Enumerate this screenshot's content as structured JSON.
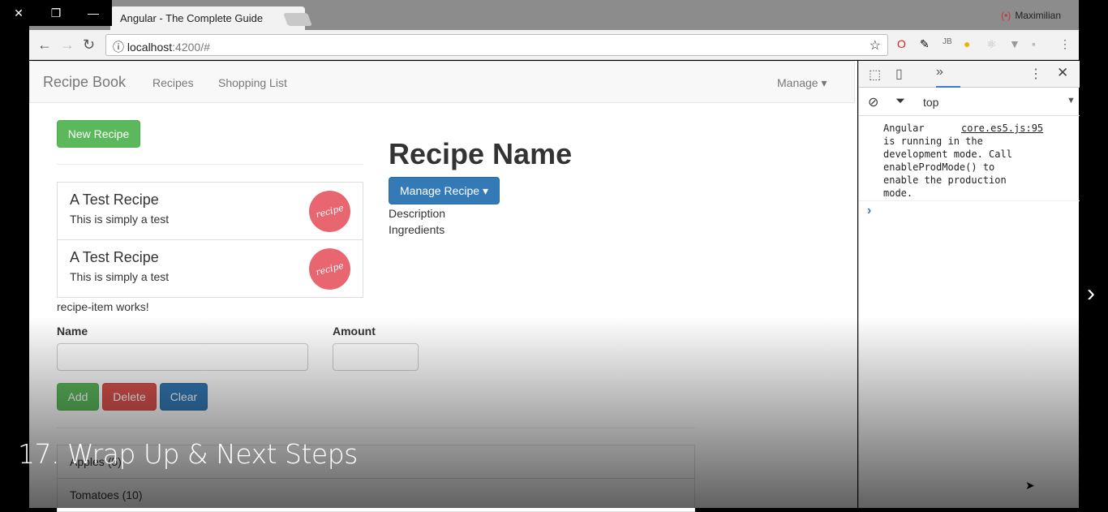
{
  "window_controls": {
    "close": "✕",
    "restore": "❐",
    "minimize": "—"
  },
  "browser": {
    "tab_title": "Angular - The Complete Guide",
    "tab_close": "×",
    "user": "Maximilian",
    "url_host": "localhost",
    "url_rest": ":4200/#"
  },
  "navbar": {
    "brand": "Recipe Book",
    "links": [
      "Recipes",
      "Shopping List"
    ],
    "manage": "Manage ▾"
  },
  "recipes": {
    "new_button": "New Recipe",
    "items": [
      {
        "name": "A Test Recipe",
        "description": "This is simply a test",
        "image_text": "recipe"
      },
      {
        "name": "A Test Recipe",
        "description": "This is simply a test",
        "image_text": "recipe"
      }
    ],
    "item_works": "recipe-item works!"
  },
  "detail": {
    "title": "Recipe Name",
    "manage_button": "Manage Recipe ▾",
    "description": "Description",
    "ingredients": "Ingredients"
  },
  "shopping": {
    "name_label": "Name",
    "amount_label": "Amount",
    "add": "Add",
    "delete": "Delete",
    "clear": "Clear",
    "items": [
      "Apples (5)",
      "Tomatoes (10)"
    ]
  },
  "devtools": {
    "context": "top",
    "console_source": "core.es5.js:95",
    "console_lines": [
      "Angular",
      "is running in the",
      "development mode. Call",
      "enableProdMode() to",
      "enable the production",
      "mode."
    ],
    "prompt": "›"
  },
  "video": {
    "caption": "17. Wrap Up & Next Steps"
  }
}
